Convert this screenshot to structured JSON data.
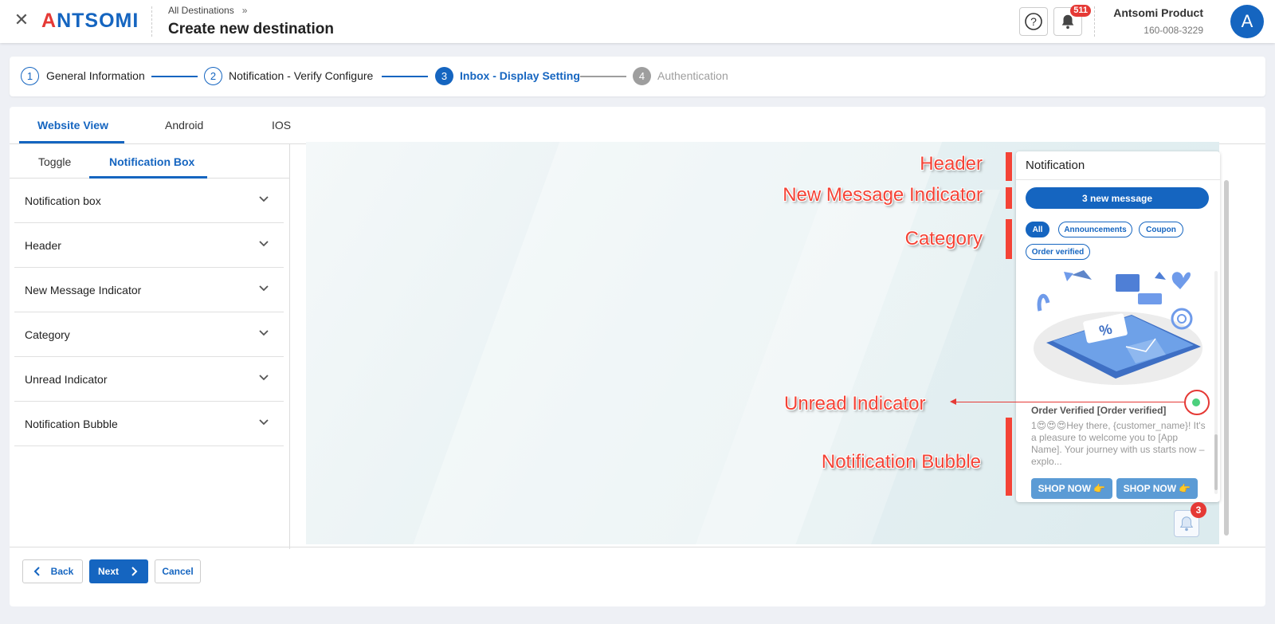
{
  "header": {
    "logo": "ANTSOMI",
    "breadcrumb": "All Destinations",
    "breadcrumb_sep": "»",
    "title": "Create new destination",
    "notification_count": "511",
    "account_name": "Antsomi Product",
    "account_id": "160-008-3229",
    "avatar_letter": "A"
  },
  "stepper": {
    "steps": [
      {
        "number": "1",
        "label": "General Information",
        "state": "done"
      },
      {
        "number": "2",
        "label": "Notification - Verify Configure",
        "state": "done"
      },
      {
        "number": "3",
        "label": "Inbox - Display Setting",
        "state": "active"
      },
      {
        "number": "4",
        "label": "Authentication",
        "state": "pending"
      }
    ]
  },
  "view_tabs": [
    "Website View",
    "Android",
    "IOS"
  ],
  "sub_tabs": [
    "Toggle",
    "Notification Box"
  ],
  "accordion": [
    "Notification box",
    "Header",
    "New Message Indicator",
    "Category",
    "Unread Indicator",
    "Notification Bubble"
  ],
  "preview": {
    "annotations": {
      "header": "Header",
      "new_message": "New Message Indicator",
      "category": "Category",
      "unread": "Unread Indicator",
      "bubble": "Notification Bubble"
    },
    "box_title": "Notification",
    "new_message_label": "3 new message",
    "categories": [
      "All",
      "Announcements",
      "Coupon",
      "Order verified"
    ],
    "item_title": "Order Verified [Order verified]",
    "item_body": "1😍😍😍Hey there, {customer_name}! It's a pleasure to welcome you to [App Name]. Your journey with us starts now – explo...",
    "shop_button_1": "SHOP NOW 👉",
    "shop_button_2": "SHOP NOW 👉",
    "bell_badge": "3"
  },
  "footer": {
    "back": "Back",
    "next": "Next",
    "cancel": "Cancel"
  },
  "colors": {
    "primary": "#1565c0",
    "annotation": "#f44336",
    "unread_dot": "#4cd07d",
    "badge": "#e53935"
  }
}
